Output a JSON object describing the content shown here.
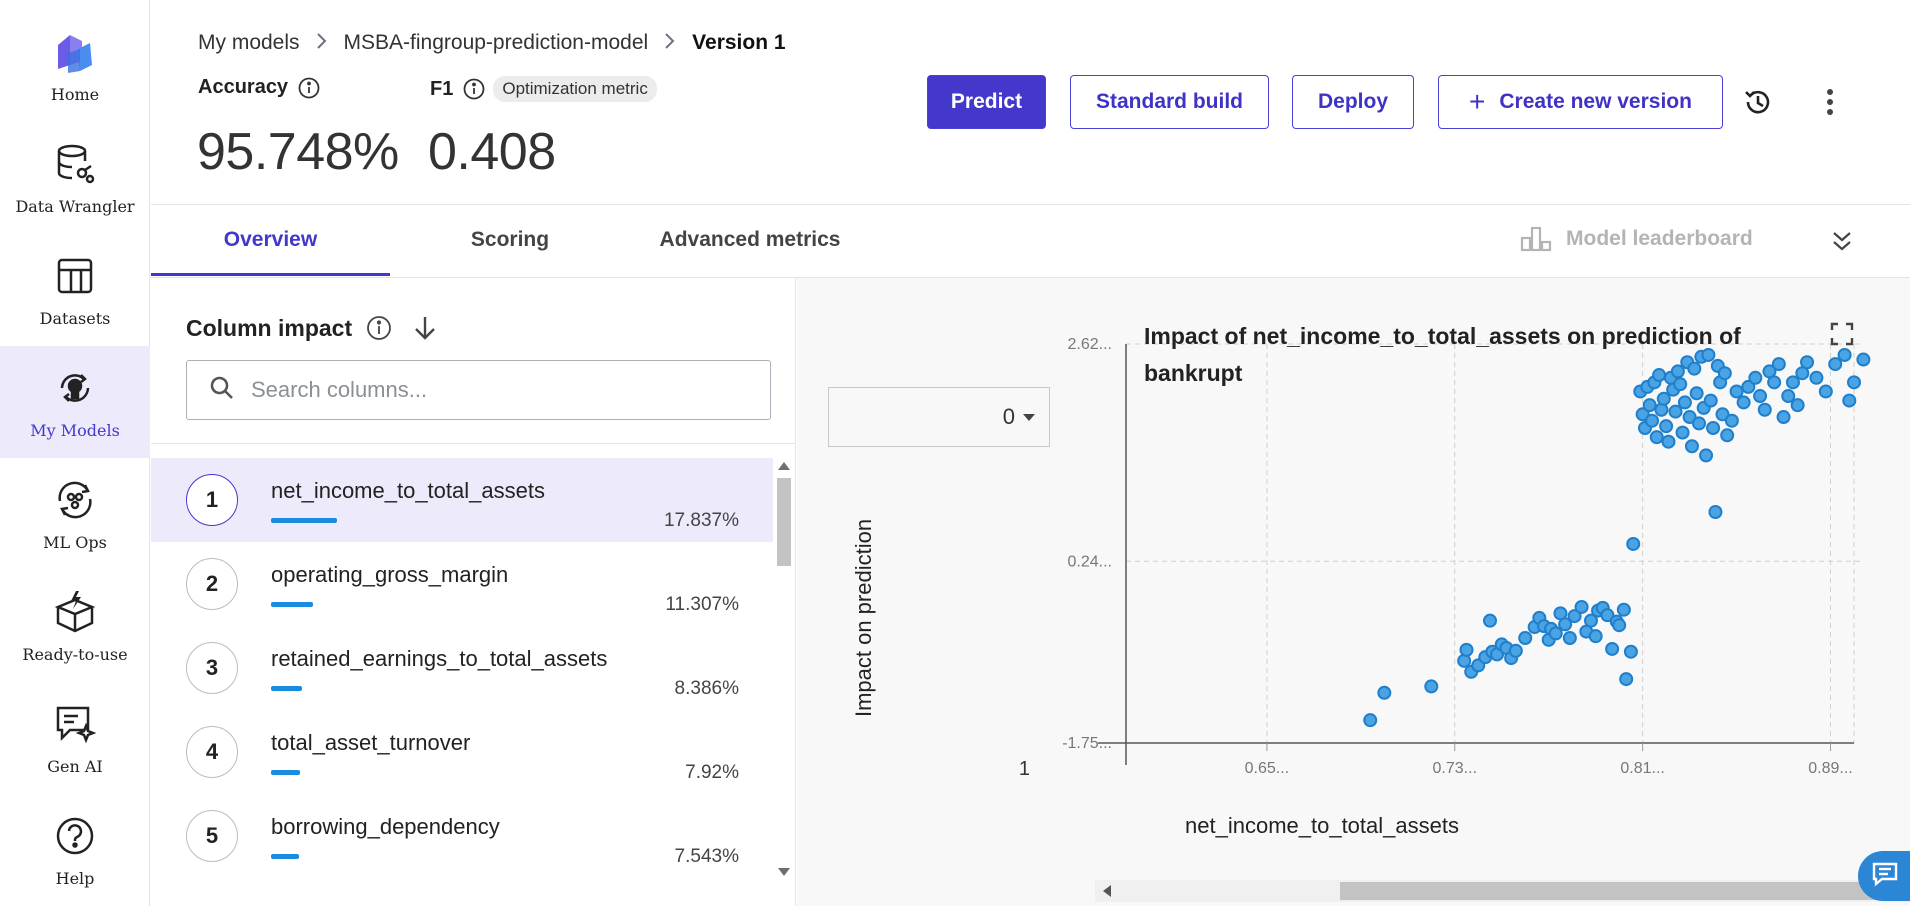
{
  "sidebar": {
    "items": [
      {
        "label": "Home",
        "icon": "logo-icon"
      },
      {
        "label": "Data Wrangler",
        "icon": "database-icon"
      },
      {
        "label": "Datasets",
        "icon": "table-icon"
      },
      {
        "label": "My Models",
        "icon": "bulb-icon",
        "active": true
      },
      {
        "label": "ML Ops",
        "icon": "ml-ops-icon"
      },
      {
        "label": "Ready-to-use",
        "icon": "box-icon"
      },
      {
        "label": "Gen AI",
        "icon": "chat-sparkle-icon"
      },
      {
        "label": "Help",
        "icon": "help-icon"
      }
    ]
  },
  "breadcrumb": {
    "root": "My models",
    "model": "MSBA-fingroup-prediction-model",
    "version": "Version 1"
  },
  "metrics": {
    "accuracy_label": "Accuracy",
    "accuracy_value": "95.748%",
    "f1_label": "F1",
    "f1_badge": "Optimization metric",
    "f1_value": "0.408"
  },
  "actions": {
    "predict": "Predict",
    "standard_build": "Standard build",
    "deploy": "Deploy",
    "create_version": "Create new version"
  },
  "tabs": [
    {
      "label": "Overview",
      "active": true
    },
    {
      "label": "Scoring"
    },
    {
      "label": "Advanced metrics"
    }
  ],
  "leaderboard_label": "Model leaderboard",
  "column_impact": {
    "title": "Column impact",
    "search_placeholder": "Search columns...",
    "columns": [
      {
        "rank": "1",
        "name": "net_income_to_total_assets",
        "pct": "17.837%",
        "value": 17.837,
        "selected": true
      },
      {
        "rank": "2",
        "name": "operating_gross_margin",
        "pct": "11.307%",
        "value": 11.307
      },
      {
        "rank": "3",
        "name": "retained_earnings_to_total_assets",
        "pct": "8.386%",
        "value": 8.386
      },
      {
        "rank": "4",
        "name": "total_asset_turnover",
        "pct": "7.92%",
        "value": 7.92
      },
      {
        "rank": "5",
        "name": "borrowing_dependency",
        "pct": "7.543%",
        "value": 7.543
      }
    ]
  },
  "chart_panel": {
    "class_select": "0",
    "side_marker": "1"
  },
  "colors": {
    "accent": "#4337cc",
    "point": "#4aa3e3",
    "point_stroke": "#1f7fcc",
    "bar": "#1a8ce0"
  },
  "chart_data": {
    "type": "scatter",
    "title": "Impact of net_income_to_total_assets on prediction of bankrupt",
    "xlabel": "net_income_to_total_assets",
    "ylabel": "Impact on prediction",
    "x_ticks": [
      "0.65...",
      "0.73...",
      "0.81...",
      "0.89..."
    ],
    "x_tick_values": [
      0.65,
      0.73,
      0.81,
      0.89
    ],
    "y_ticks": [
      "2.62...",
      "0.24...",
      "-1.75..."
    ],
    "y_tick_values": [
      2.62,
      0.24,
      -1.75
    ],
    "xlim": [
      0.59,
      0.9
    ],
    "ylim": [
      -1.75,
      2.62
    ],
    "grid": true,
    "points": [
      [
        0.694,
        -1.5
      ],
      [
        0.7,
        -1.2
      ],
      [
        0.72,
        -1.13
      ],
      [
        0.734,
        -0.85
      ],
      [
        0.735,
        -0.73
      ],
      [
        0.737,
        -0.97
      ],
      [
        0.74,
        -0.9
      ],
      [
        0.743,
        -0.81
      ],
      [
        0.745,
        -0.41
      ],
      [
        0.746,
        -0.75
      ],
      [
        0.748,
        -0.78
      ],
      [
        0.75,
        -0.67
      ],
      [
        0.752,
        -0.71
      ],
      [
        0.754,
        -0.82
      ],
      [
        0.756,
        -0.74
      ],
      [
        0.76,
        -0.6
      ],
      [
        0.764,
        -0.48
      ],
      [
        0.766,
        -0.38
      ],
      [
        0.768,
        -0.47
      ],
      [
        0.77,
        -0.62
      ],
      [
        0.771,
        -0.5
      ],
      [
        0.773,
        -0.55
      ],
      [
        0.775,
        -0.33
      ],
      [
        0.777,
        -0.45
      ],
      [
        0.779,
        -0.6
      ],
      [
        0.781,
        -0.36
      ],
      [
        0.784,
        -0.26
      ],
      [
        0.786,
        -0.53
      ],
      [
        0.788,
        -0.41
      ],
      [
        0.79,
        -0.58
      ],
      [
        0.791,
        -0.3
      ],
      [
        0.793,
        -0.27
      ],
      [
        0.795,
        -0.35
      ],
      [
        0.797,
        -0.72
      ],
      [
        0.799,
        -0.42
      ],
      [
        0.8,
        -0.46
      ],
      [
        0.802,
        -0.29
      ],
      [
        0.803,
        -1.05
      ],
      [
        0.805,
        -0.75
      ],
      [
        0.806,
        0.43
      ],
      [
        0.809,
        2.1
      ],
      [
        0.81,
        1.85
      ],
      [
        0.811,
        1.7
      ],
      [
        0.812,
        2.15
      ],
      [
        0.813,
        1.95
      ],
      [
        0.814,
        1.78
      ],
      [
        0.815,
        2.2
      ],
      [
        0.816,
        1.6
      ],
      [
        0.817,
        2.28
      ],
      [
        0.818,
        1.9
      ],
      [
        0.819,
        2.02
      ],
      [
        0.82,
        1.72
      ],
      [
        0.821,
        1.55
      ],
      [
        0.822,
        2.25
      ],
      [
        0.823,
        2.12
      ],
      [
        0.824,
        1.88
      ],
      [
        0.825,
        2.32
      ],
      [
        0.826,
        2.18
      ],
      [
        0.827,
        1.65
      ],
      [
        0.828,
        1.98
      ],
      [
        0.829,
        2.42
      ],
      [
        0.83,
        1.82
      ],
      [
        0.831,
        1.5
      ],
      [
        0.832,
        2.35
      ],
      [
        0.833,
        2.08
      ],
      [
        0.834,
        1.75
      ],
      [
        0.835,
        2.48
      ],
      [
        0.836,
        1.92
      ],
      [
        0.837,
        1.4
      ],
      [
        0.838,
        2.5
      ],
      [
        0.839,
        2.0
      ],
      [
        0.84,
        1.7
      ],
      [
        0.841,
        0.78
      ],
      [
        0.842,
        2.38
      ],
      [
        0.843,
        2.2
      ],
      [
        0.844,
        1.85
      ],
      [
        0.845,
        2.3
      ],
      [
        0.846,
        1.62
      ],
      [
        0.848,
        1.78
      ],
      [
        0.85,
        2.1
      ],
      [
        0.853,
        1.98
      ],
      [
        0.855,
        2.15
      ],
      [
        0.858,
        2.25
      ],
      [
        0.86,
        2.05
      ],
      [
        0.862,
        1.9
      ],
      [
        0.864,
        2.32
      ],
      [
        0.866,
        2.2
      ],
      [
        0.868,
        2.4
      ],
      [
        0.87,
        1.82
      ],
      [
        0.872,
        2.05
      ],
      [
        0.874,
        2.2
      ],
      [
        0.876,
        1.95
      ],
      [
        0.878,
        2.3
      ],
      [
        0.88,
        2.42
      ],
      [
        0.884,
        2.25
      ],
      [
        0.888,
        2.1
      ],
      [
        0.892,
        2.4
      ],
      [
        0.896,
        2.5
      ],
      [
        0.898,
        2.0
      ],
      [
        0.9,
        2.2
      ],
      [
        0.904,
        2.45
      ]
    ]
  }
}
